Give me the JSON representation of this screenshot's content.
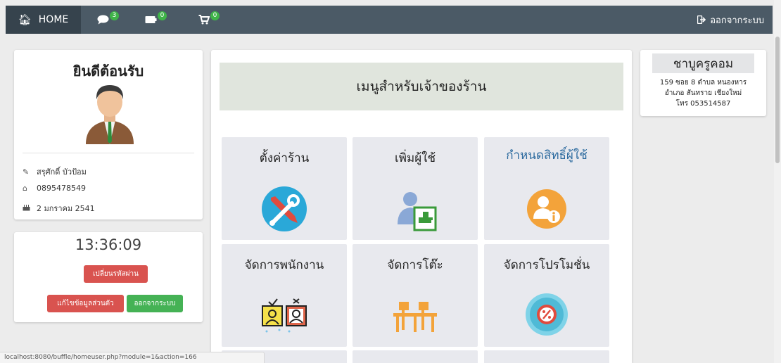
{
  "navbar": {
    "home_icon": "home-icon",
    "home_label": "HOME",
    "chat_count": "3",
    "tv_count": "0",
    "cart_count": "0",
    "logout_label": "ออกจากระบบ",
    "colors": {
      "bar": "#4b5a66",
      "active": "#36434d",
      "badge": "#3fb448"
    }
  },
  "welcome": {
    "title": "ยินดีต้อนรับ",
    "name": "สรุศักดิ์ บัวป้อม",
    "phone": "0895478549",
    "birth_date": "2 มกราคม 2541"
  },
  "clock_panel": {
    "time": "13:36:09",
    "change_password": "เปลี่ยนรหัสผ่าน",
    "edit_profile": "แก้ไขข้อมูลส่วนตัว",
    "logout": "ออกจากระบบ"
  },
  "main": {
    "header": "เมนูสำหรับเจ้าของร้าน",
    "tiles": [
      {
        "label": "ตั้งค่าร้าน",
        "icon": "tools-icon"
      },
      {
        "label": "เพิ่มผู้ใช้",
        "icon": "add-user-icon"
      },
      {
        "label": "กำหนดสิทธิ์ผู้ใช้",
        "icon": "user-permission-icon"
      },
      {
        "label": "จัดการพนักงาน",
        "icon": "staff-icon"
      },
      {
        "label": "จัดการโต๊ะ",
        "icon": "table-icon"
      },
      {
        "label": "จัดการโปรโมชั่น",
        "icon": "promotion-icon"
      }
    ]
  },
  "store": {
    "name": "ชาบูครูคอม",
    "address_line1": "159 ซอย 8 ตำบล หนองหาร",
    "address_line2": "อำเภอ สันทราย เชียงใหม่",
    "phone": "โทร 053514587"
  },
  "status_bar": {
    "url": "localhost:8080/buffle/homeuser.php?module=1&action=166"
  }
}
